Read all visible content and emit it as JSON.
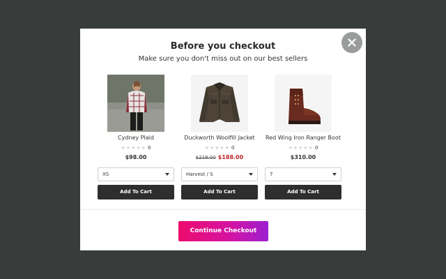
{
  "modal": {
    "title": "Before you checkout",
    "subtitle": "Make sure you don't miss out on our best sellers",
    "continue_label": "Continue Checkout"
  },
  "products": [
    {
      "name": "Cydney Plaid",
      "rating_stars": "★★★★★",
      "rating_count": "0",
      "price": "$98.00",
      "old_price": "",
      "sale_price": "",
      "option": "XS",
      "button": "Add To Cart"
    },
    {
      "name": "Duckworth Woolfill Jacket",
      "rating_stars": "★★★★★",
      "rating_count": "0",
      "price": "",
      "old_price": "$218.00",
      "sale_price": "$188.00",
      "option": "Harvest / S",
      "button": "Add To Cart"
    },
    {
      "name": "Red Wing Iron Ranger Boot",
      "rating_stars": "★★★★★",
      "rating_count": "0",
      "price": "$310.00",
      "old_price": "",
      "sale_price": "",
      "option": "7",
      "button": "Add To Cart"
    }
  ],
  "colors": {
    "backdrop": "#383d3c",
    "button_dark": "#2e2e2e",
    "sale_red": "#c0262b",
    "gradient_start": "#ee0b6d",
    "gradient_end": "#9b1fd0"
  },
  "icons": {
    "close": "close-icon",
    "dropdown": "chevron-down-icon",
    "star": "star-icon"
  }
}
